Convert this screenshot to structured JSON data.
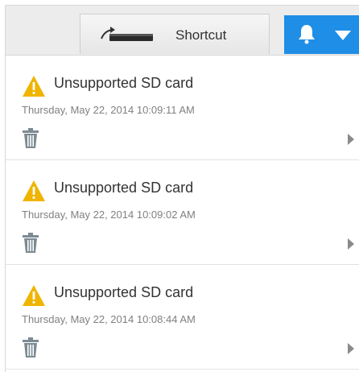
{
  "toolbar": {
    "shortcut_label": "Shortcut",
    "shortcut_icon": "shortcut-device-icon",
    "notifications_icon": "bell-icon",
    "dropdown_icon": "chevron-down-icon",
    "accent_color": "#1f8ee6"
  },
  "notifications": [
    {
      "icon": "warning-icon",
      "title": "Unsupported SD card",
      "time": "Thursday, May 22, 2014 10:09:11 AM"
    },
    {
      "icon": "warning-icon",
      "title": "Unsupported SD card",
      "time": "Thursday, May 22, 2014 10:09:02 AM"
    },
    {
      "icon": "warning-icon",
      "title": "Unsupported SD card",
      "time": "Thursday, May 22, 2014 10:08:44 AM"
    }
  ]
}
